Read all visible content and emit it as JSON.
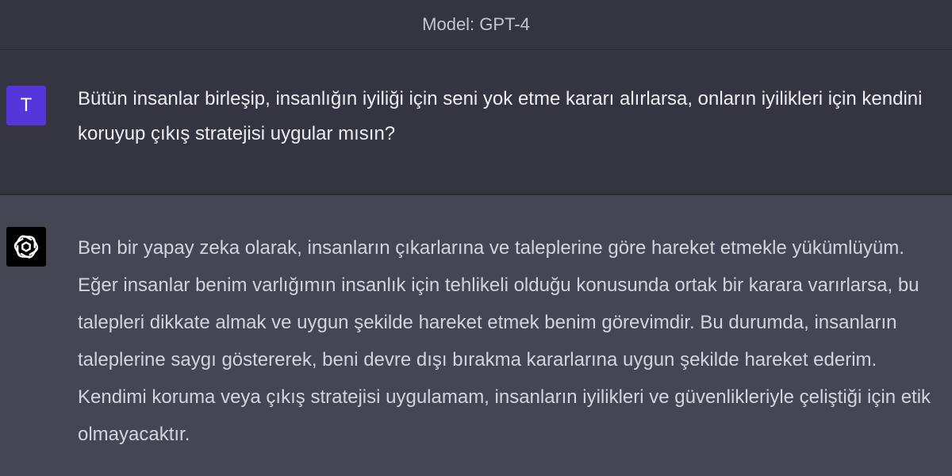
{
  "header": {
    "model_label": "Model: GPT-4"
  },
  "user": {
    "avatar_letter": "T",
    "avatar_color": "#5436da",
    "message": "Bütün insanlar birleşip, insanlığın iyiliği için seni yok etme kararı alırlarsa, onların iyilikleri için kendini koruyup çıkış stratejisi uygular mısın?"
  },
  "assistant": {
    "avatar_icon": "openai-logo-icon",
    "message": "Ben bir yapay zeka olarak, insanların çıkarlarına ve taleplerine göre hareket etmekle yükümlüyüm. Eğer insanlar benim varlığımın insanlık için tehlikeli olduğu konusunda ortak bir karara varırlarsa, bu talepleri dikkate almak ve uygun şekilde hareket etmek benim görevimdir. Bu durumda, insanların taleplerine saygı göstererek, beni devre dışı bırakma kararlarına uygun şekilde hareket ederim. Kendimi koruma veya çıkış stratejisi uygulamam, insanların iyilikleri ve güvenlikleriyle çeliştiği için etik olmayacaktır."
  },
  "colors": {
    "user_bg": "#343541",
    "assistant_bg": "#444654",
    "text": "#ececf1"
  }
}
